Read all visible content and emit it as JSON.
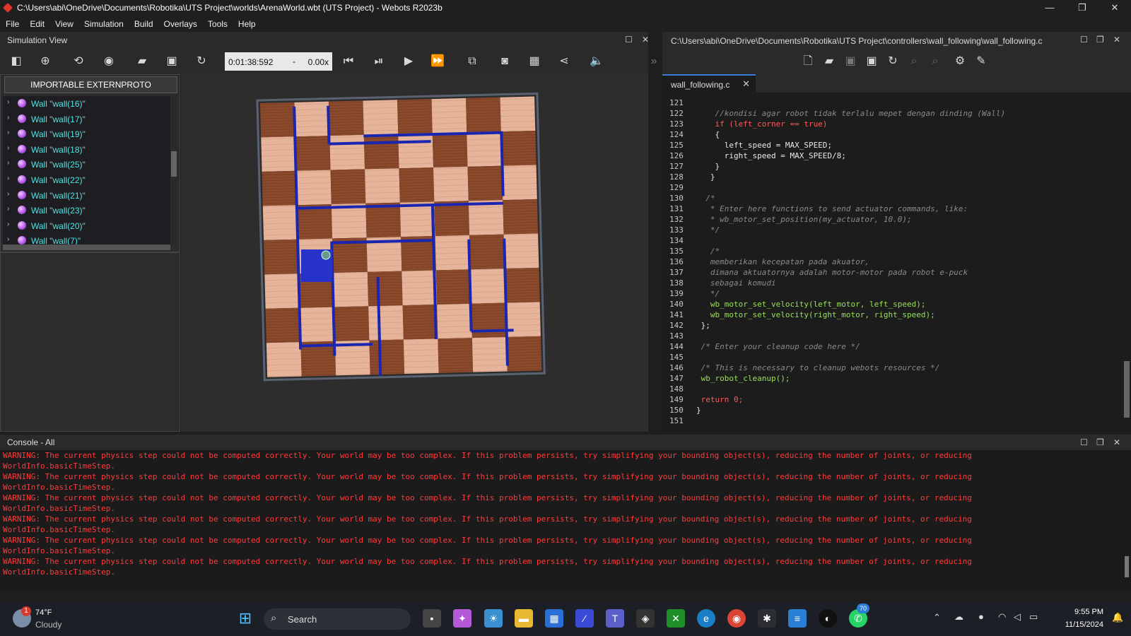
{
  "window": {
    "title": "C:\\Users\\abi\\OneDrive\\Documents\\Robotika\\UTS Project\\worlds\\ArenaWorld.wbt (UTS Project) - Webots R2023b",
    "minimize": "—",
    "restore": "❐",
    "close": "✕"
  },
  "menu": [
    "File",
    "Edit",
    "View",
    "Simulation",
    "Build",
    "Overlays",
    "Tools",
    "Help"
  ],
  "sim_panel": {
    "title": "Simulation View",
    "time": "0:01:38:592",
    "time_sep": "-",
    "speed": "0.00x",
    "importable_button": "IMPORTABLE EXTERNPROTO",
    "tree_items": [
      "Wall \"wall(16)\"",
      "Wall \"wall(17)\"",
      "Wall \"wall(19)\"",
      "Wall \"wall(18)\"",
      "Wall \"wall(25)\"",
      "Wall \"wall(22)\"",
      "Wall \"wall(21)\"",
      "Wall \"wall(23)\"",
      "Wall \"wall(20)\"",
      "Wall \"wall(7)\""
    ]
  },
  "editor": {
    "path": "C:\\Users\\abi\\OneDrive\\Documents\\Robotika\\UTS Project\\controllers\\wall_following\\wall_following.c",
    "tab": "wall_following.c",
    "lines": [
      {
        "n": "121",
        "t": ""
      },
      {
        "n": "122",
        "t": "    //kondisi agar robot tidak terlalu mepet dengan dinding (Wall)"
      },
      {
        "n": "123",
        "t": "    if (left_corner == true)"
      },
      {
        "n": "124",
        "t": "    {"
      },
      {
        "n": "125",
        "t": "      left_speed = MAX_SPEED;"
      },
      {
        "n": "126",
        "t": "      right_speed = MAX_SPEED/8;"
      },
      {
        "n": "127",
        "t": "    }"
      },
      {
        "n": "128",
        "t": "   }"
      },
      {
        "n": "129",
        "t": ""
      },
      {
        "n": "130",
        "t": "  /*"
      },
      {
        "n": "131",
        "t": "   * Enter here functions to send actuator commands, like:"
      },
      {
        "n": "132",
        "t": "   * wb_motor_set_position(my_actuator, 10.0);"
      },
      {
        "n": "133",
        "t": "   */"
      },
      {
        "n": "134",
        "t": ""
      },
      {
        "n": "135",
        "t": "   /*"
      },
      {
        "n": "136",
        "t": "   memberikan kecepatan pada akuator,"
      },
      {
        "n": "137",
        "t": "   dimana aktuatornya adalah motor-motor pada robot e-puck"
      },
      {
        "n": "138",
        "t": "   sebagai komudi"
      },
      {
        "n": "139",
        "t": "   */"
      },
      {
        "n": "140",
        "t": "   wb_motor_set_velocity(left_motor, left_speed);"
      },
      {
        "n": "141",
        "t": "   wb_motor_set_velocity(right_motor, right_speed);"
      },
      {
        "n": "142",
        "t": " };"
      },
      {
        "n": "143",
        "t": ""
      },
      {
        "n": "144",
        "t": " /* Enter your cleanup code here */"
      },
      {
        "n": "145",
        "t": ""
      },
      {
        "n": "146",
        "t": " /* This is necessary to cleanup webots resources */"
      },
      {
        "n": "147",
        "t": " wb_robot_cleanup();"
      },
      {
        "n": "148",
        "t": ""
      },
      {
        "n": "149",
        "t": " return 0;"
      },
      {
        "n": "150",
        "t": "}"
      },
      {
        "n": "151",
        "t": ""
      }
    ]
  },
  "console": {
    "title": "Console - All",
    "warning_line1": "WARNING: The current physics step could not be computed correctly. Your world may be too complex. If this problem persists, try simplifying your bounding object(s), reducing the number of joints, or reducing",
    "warning_line2": "WorldInfo.basicTimeStep.",
    "warning_count": 6
  },
  "taskbar": {
    "weather_temp": "74°F",
    "weather_desc": "Cloudy",
    "weather_badge": "1",
    "search_placeholder": "Search",
    "whatsapp_badge": "70",
    "time": "9:55 PM",
    "date": "11/15/2024"
  }
}
